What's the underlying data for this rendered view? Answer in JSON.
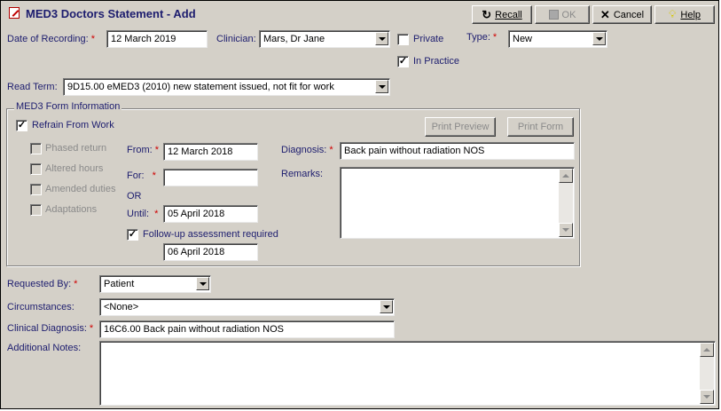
{
  "window": {
    "title": "MED3 Doctors Statement - Add"
  },
  "toolbar": {
    "recall": "Recall",
    "ok": "OK",
    "cancel": "Cancel",
    "help": "Help"
  },
  "recording": {
    "date_label": "Date of Recording:",
    "date_value": "12 March 2019",
    "clinician_label": "Clinician:",
    "clinician_value": "Mars, Dr Jane",
    "private_label": "Private",
    "private_checked": false,
    "type_label": "Type:",
    "type_value": "New",
    "in_practice_label": "In Practice",
    "in_practice_checked": true,
    "read_term_label": "Read Term:",
    "read_term_value": "9D15.00 eMED3 (2010) new statement issued, not fit for work"
  },
  "med3": {
    "group_title": "MED3 Form Information",
    "refrain_label": "Refrain From Work",
    "refrain_checked": true,
    "print_preview": "Print Preview",
    "print_form": "Print Form",
    "options": [
      "Phased return",
      "Altered hours",
      "Amended duties",
      "Adaptations"
    ],
    "from_label": "From:",
    "from_value": "12 March 2018",
    "for_label": "For:",
    "for_value": "",
    "or_label": "OR",
    "until_label": "Until:",
    "until_value": "05 April 2018",
    "followup_label": "Follow-up assessment required",
    "followup_checked": true,
    "followup_date": "06 April 2018",
    "diagnosis_label": "Diagnosis:",
    "diagnosis_value": "Back pain without radiation NOS",
    "remarks_label": "Remarks:",
    "remarks_value": ""
  },
  "bottom": {
    "requested_by_label": "Requested By:",
    "requested_by_value": "Patient",
    "circumstances_label": "Circumstances:",
    "circumstances_value": "<None>",
    "clinical_diagnosis_label": "Clinical Diagnosis:",
    "clinical_diagnosis_value": "16C6.00 Back pain without radiation NOS",
    "additional_notes_label": "Additional Notes:",
    "additional_notes_value": ""
  },
  "required_mark": "*",
  "icons": [
    "med3-form-icon",
    "recall-icon",
    "save-disk-icon",
    "cancel-x-icon",
    "help-lightbulb-icon"
  ]
}
